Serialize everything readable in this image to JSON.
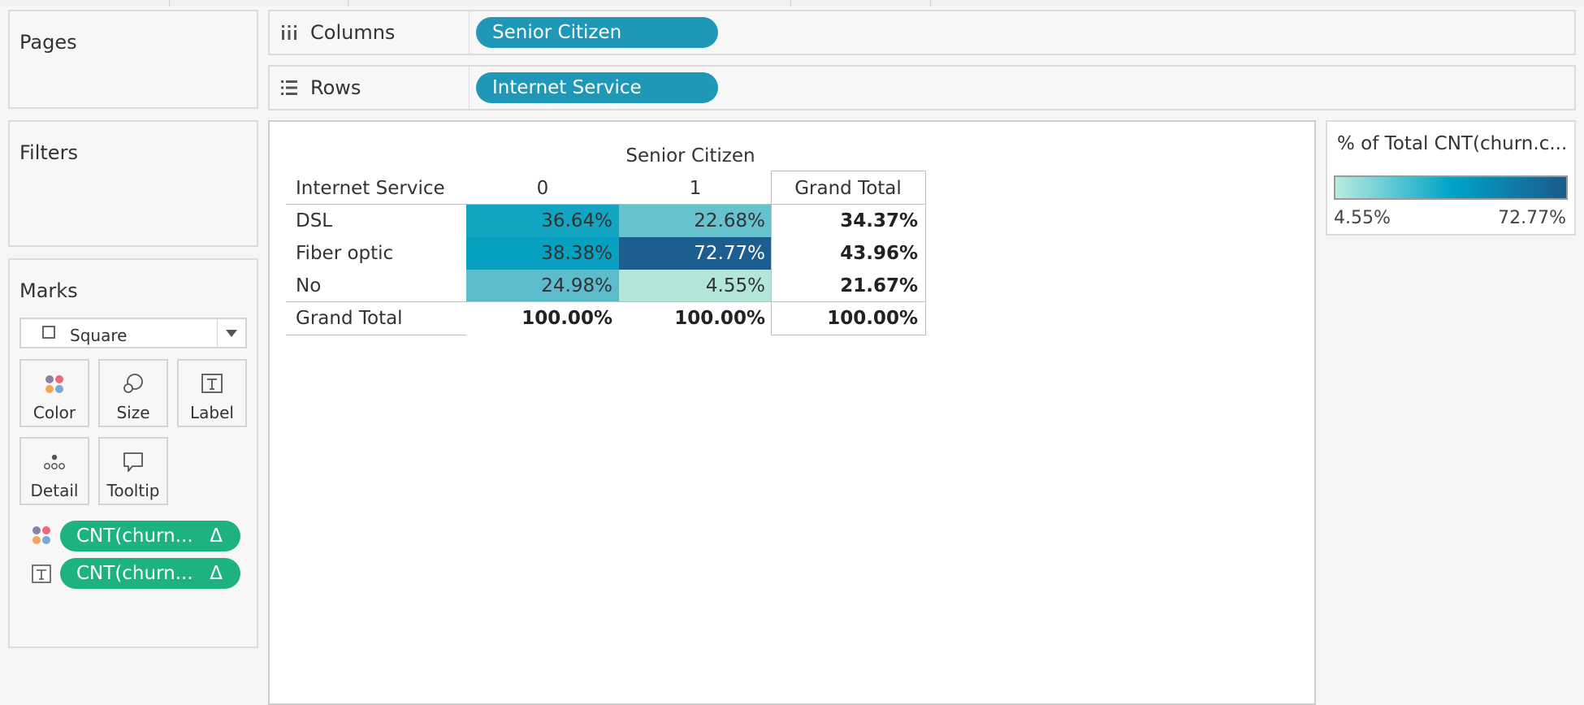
{
  "shelves": {
    "pages": "Pages",
    "filters": "Filters",
    "marks": "Marks",
    "columns_label": "Columns",
    "rows_label": "Rows",
    "columns_pill": "Senior Citizen",
    "rows_pill": "Internet Service"
  },
  "marks_card": {
    "mark_type": "Square",
    "buttons": {
      "color": "Color",
      "size": "Size",
      "label": "Label",
      "detail": "Detail",
      "tooltip": "Tooltip"
    },
    "fields": [
      {
        "icon": "color-dots-icon",
        "text": "CNT(churn...",
        "badge": "Δ"
      },
      {
        "icon": "text-label-icon",
        "text": "CNT(churn...",
        "badge": "Δ"
      }
    ]
  },
  "crosstab": {
    "column_header": "Senior Citizen",
    "row_header": "Internet Service",
    "col_values": [
      "0",
      "1"
    ],
    "grand_total_label": "Grand Total",
    "rows": [
      {
        "label": "DSL",
        "c0": "36.64%",
        "c1": "22.68%",
        "total": "34.37%"
      },
      {
        "label": "Fiber optic",
        "c0": "38.38%",
        "c1": "72.77%",
        "total": "43.96%"
      },
      {
        "label": "No",
        "c0": "24.98%",
        "c1": "4.55%",
        "total": "21.67%"
      }
    ],
    "totals": {
      "label": "Grand Total",
      "c0": "100.00%",
      "c1": "100.00%",
      "total": "100.00%"
    },
    "heat_values": [
      [
        36.64,
        22.68
      ],
      [
        38.38,
        72.77
      ],
      [
        24.98,
        4.55
      ]
    ],
    "heat_colors": [
      [
        "#12a5c2",
        "#66c2cc"
      ],
      [
        "#06a1c0",
        "#1b5e8f"
      ],
      [
        "#5dbccc",
        "#b3e6da"
      ]
    ]
  },
  "legend": {
    "title": "% of Total CNT(churn.c...",
    "min": "4.55%",
    "max": "72.77%",
    "gradient": [
      "#b9ece0",
      "#00a4c6",
      "#1b5a8c"
    ]
  }
}
